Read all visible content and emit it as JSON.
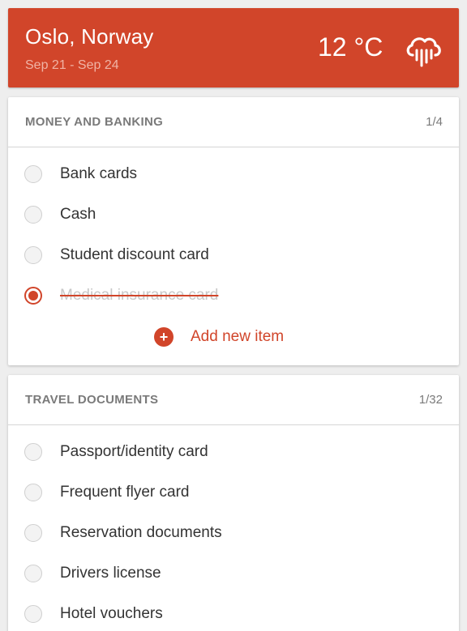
{
  "trip": {
    "city": "Oslo, Norway",
    "dates": "Sep 21 - Sep 24",
    "temperature": "12 °C",
    "weather_icon": "rain-cloud-icon"
  },
  "colors": {
    "accent": "#d1452a",
    "background": "#eeeeee"
  },
  "sections": [
    {
      "title": "MONEY AND BANKING",
      "count": "1/4",
      "items": [
        {
          "label": "Bank cards",
          "checked": false
        },
        {
          "label": "Cash",
          "checked": false
        },
        {
          "label": "Student discount card",
          "checked": false
        },
        {
          "label": "Medical insurance card",
          "checked": true
        }
      ],
      "add_label": "Add new item"
    },
    {
      "title": "TRAVEL DOCUMENTS",
      "count": "1/32",
      "items": [
        {
          "label": "Passport/identity card",
          "checked": false
        },
        {
          "label": "Frequent flyer card",
          "checked": false
        },
        {
          "label": "Reservation documents",
          "checked": false
        },
        {
          "label": "Drivers license",
          "checked": false
        },
        {
          "label": "Hotel vouchers",
          "checked": false
        }
      ]
    }
  ]
}
